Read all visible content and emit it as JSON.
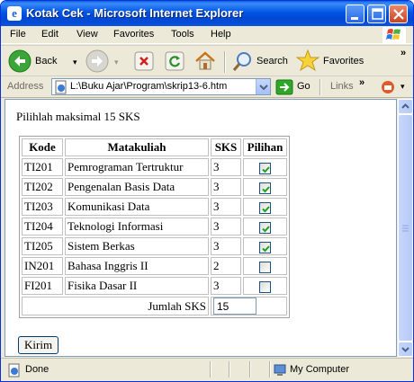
{
  "window": {
    "title": "Kotak Cek - Microsoft Internet Explorer"
  },
  "menu": [
    "File",
    "Edit",
    "View",
    "Favorites",
    "Tools",
    "Help"
  ],
  "toolbar": {
    "back_label": "Back",
    "search_label": "Search",
    "favorites_label": "Favorites",
    "overflow": "»"
  },
  "address": {
    "label": "Address",
    "value": "L:\\Buku Ajar\\Program\\skrip13-6.htm",
    "go_label": "Go",
    "links_label": "Links",
    "links_overflow": "»"
  },
  "page": {
    "instruction": "Pilihlah maksimal 15 SKS",
    "table": {
      "headers": [
        "Kode",
        "Matakuliah",
        "SKS",
        "Pilihan"
      ],
      "rows": [
        {
          "kode": "TI201",
          "matakuliah": "Pemrograman Tertruktur",
          "sks": "3",
          "checked": true
        },
        {
          "kode": "TI202",
          "matakuliah": "Pengenalan Basis Data",
          "sks": "3",
          "checked": true
        },
        {
          "kode": "TI203",
          "matakuliah": "Komunikasi Data",
          "sks": "3",
          "checked": true
        },
        {
          "kode": "TI204",
          "matakuliah": "Teknologi Informasi",
          "sks": "3",
          "checked": true
        },
        {
          "kode": "TI205",
          "matakuliah": "Sistem Berkas",
          "sks": "3",
          "checked": true
        },
        {
          "kode": "IN201",
          "matakuliah": "Bahasa Inggris II",
          "sks": "2",
          "checked": false
        },
        {
          "kode": "FI201",
          "matakuliah": "Fisika Dasar II",
          "sks": "3",
          "checked": false
        }
      ],
      "total_label": "Jumlah SKS",
      "total_value": "15"
    },
    "submit_label": "Kirim"
  },
  "status": {
    "text": "Done",
    "zone": "My Computer"
  },
  "colors": {
    "titlebar": "#0055e5",
    "check": "#21a121",
    "go_arrow": "#2fa52a"
  }
}
